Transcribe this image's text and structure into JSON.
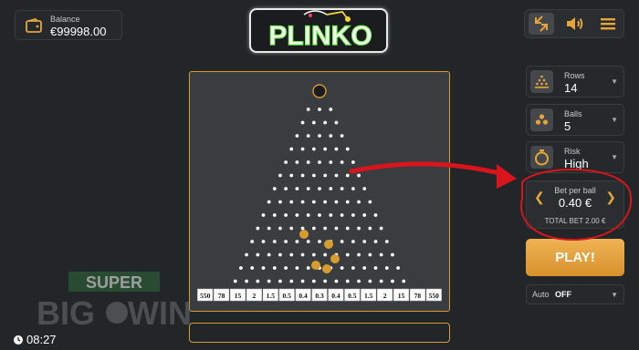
{
  "balance": {
    "label": "Balance",
    "value": "€99998.00"
  },
  "logo": {
    "text": "PLINKO"
  },
  "top_buttons": [
    "minimize-icon",
    "sound-icon",
    "menu-icon"
  ],
  "board": {
    "rows": 14,
    "multipliers": [
      "550",
      "78",
      "15",
      "2",
      "1.5",
      "0.5",
      "0.4",
      "0.3",
      "0.4",
      "0.5",
      "1.5",
      "2",
      "15",
      "78",
      "550"
    ],
    "balls_in_flight": 5
  },
  "controls": {
    "rows": {
      "label": "Rows",
      "value": "14",
      "icon": "rows-pyramid-icon"
    },
    "balls": {
      "label": "Balls",
      "value": "5",
      "icon": "balls-icon"
    },
    "risk": {
      "label": "Risk",
      "value": "High",
      "icon": "risk-icon"
    },
    "bet": {
      "label": "Bet per ball",
      "value": "0.40 €",
      "total": "TOTAL BET 2.00 €"
    },
    "play": "PLAY!",
    "auto": {
      "label": "Auto",
      "value": "OFF"
    }
  },
  "watermark": {
    "line1": "SUPER",
    "line2_a": "BIG",
    "line2_b": "WIN"
  },
  "clock": "08:27",
  "colors": {
    "accent": "#e6a43b",
    "annotation": "#d8141c",
    "board": "#3a3d40",
    "background": "#232628"
  }
}
